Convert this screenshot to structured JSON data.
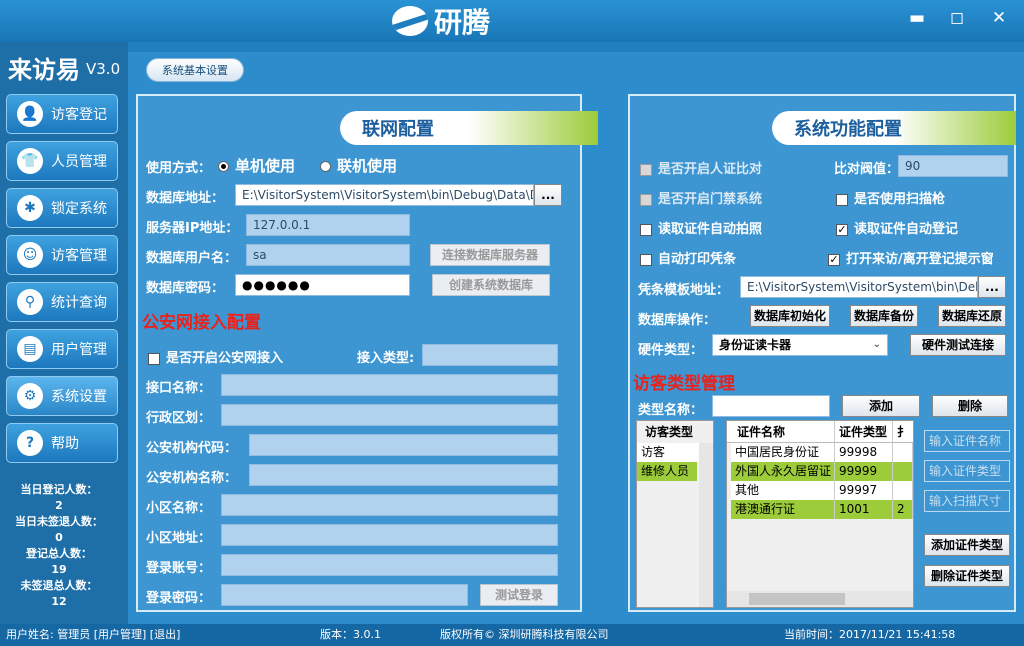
{
  "window": {
    "logo_text": "研腾",
    "min_glyph": "▬",
    "max_glyph": "◻",
    "close_glyph": "✕"
  },
  "app": {
    "title": "来访易",
    "version": "V3.0"
  },
  "nav": [
    {
      "label": "访客登记",
      "icon": "visitor-icon",
      "glyph": "👤"
    },
    {
      "label": "人员管理",
      "icon": "shirt-icon",
      "glyph": "👕"
    },
    {
      "label": "锁定系统",
      "icon": "bug-icon",
      "glyph": "✱"
    },
    {
      "label": "访客管理",
      "icon": "visitor-manage-icon",
      "glyph": "☺"
    },
    {
      "label": "统计查询",
      "icon": "magnifier-icon",
      "glyph": "⚲"
    },
    {
      "label": "用户管理",
      "icon": "user-add-icon",
      "glyph": "▤"
    },
    {
      "label": "系统设置",
      "icon": "gear-icon",
      "glyph": "⚙"
    },
    {
      "label": "帮助",
      "icon": "help-icon",
      "glyph": "?"
    }
  ],
  "stats": [
    {
      "label": "当日登记人数：",
      "value": "2"
    },
    {
      "label": "当日未签退人数：",
      "value": "0"
    },
    {
      "label": "登记总人数：",
      "value": "19"
    },
    {
      "label": "未签退总人数：",
      "value": "12"
    }
  ],
  "tab": {
    "label": "系统基本设置"
  },
  "network": {
    "title": "联网配置",
    "usage_label": "使用方式：",
    "mode_single": "单机使用",
    "mode_network": "联机使用",
    "db_path_label": "数据库地址：",
    "db_path_value": "E:\\VisitorSystem\\VisitorSystem\\bin\\Debug\\Data\\DA",
    "browse": "...",
    "server_ip_label": "服务器IP地址：",
    "server_ip_value": "127.0.0.1",
    "db_user_label": "数据库用户名：",
    "db_user_value": "sa",
    "db_pass_label": "数据库密码：",
    "db_pass_value": "●●●●●●",
    "connect_btn": "连接数据库服务器",
    "create_btn": "创建系统数据库"
  },
  "police": {
    "title": "公安网接入配置",
    "enable_label": "是否开启公安网接入",
    "access_type_label": "接入类型:",
    "fields": [
      {
        "label": "接口名称："
      },
      {
        "label": "行政区划："
      },
      {
        "label": "公安机构代码："
      },
      {
        "label": "公安机构名称："
      },
      {
        "label": "小区名称："
      },
      {
        "label": "小区地址："
      },
      {
        "label": "登录账号："
      },
      {
        "label": "登录密码："
      }
    ],
    "test_login_btn": "测试登录"
  },
  "sysfunc": {
    "title": "系统功能配置",
    "opt_face": "是否开启人证比对",
    "threshold_label": "比对阀值：",
    "threshold_value": "90",
    "opt_gate": "是否开启门禁系统",
    "opt_scan": "是否使用扫描枪",
    "opt_photo": "读取证件自动拍照",
    "opt_autoreg": "读取证件自动登记",
    "opt_print": "自动打印凭条",
    "opt_popup": "打开来访/离开登记提示窗",
    "template_label": "凭条模板地址：",
    "template_value": "E:\\VisitorSystem\\VisitorSystem\\bin\\Debu",
    "browse": "...",
    "db_ops_label": "数据库操作：",
    "db_init": "数据库初始化",
    "db_backup": "数据库备份",
    "db_restore": "数据库还原",
    "hw_label": "硬件类型：",
    "hw_value": "身份证读卡器",
    "hw_test": "硬件测试连接"
  },
  "visitor_types": {
    "title": "访客类型管理",
    "type_name_label": "类型名称：",
    "add_btn": "添加",
    "del_btn": "删除",
    "list_header": "访客类型",
    "list": [
      "访客",
      "维修人员"
    ],
    "cert_headers": [
      "证件名称",
      "证件类型",
      "扌"
    ],
    "certs": [
      {
        "name": "中国居民身份证",
        "type": "99998",
        "extra": ""
      },
      {
        "name": "外国人永久居留证",
        "type": "99999",
        "extra": ""
      },
      {
        "name": "其他",
        "type": "99997",
        "extra": ""
      },
      {
        "name": "港澳通行证",
        "type": "1001",
        "extra": "2"
      }
    ],
    "ph_cert_name": "输入证件名称",
    "ph_cert_type": "输入证件类型",
    "ph_scan_size": "输入扫描尺寸",
    "add_cert_btn": "添加证件类型",
    "del_cert_btn": "删除证件类型"
  },
  "status": {
    "user": "用户姓名: 管理员  [用户管理]  [退出]",
    "version": "版本：3.0.1",
    "copyright": "版权所有© 深圳研腾科技有限公司",
    "time": "当前时间：2017/11/21 15:41:58"
  }
}
